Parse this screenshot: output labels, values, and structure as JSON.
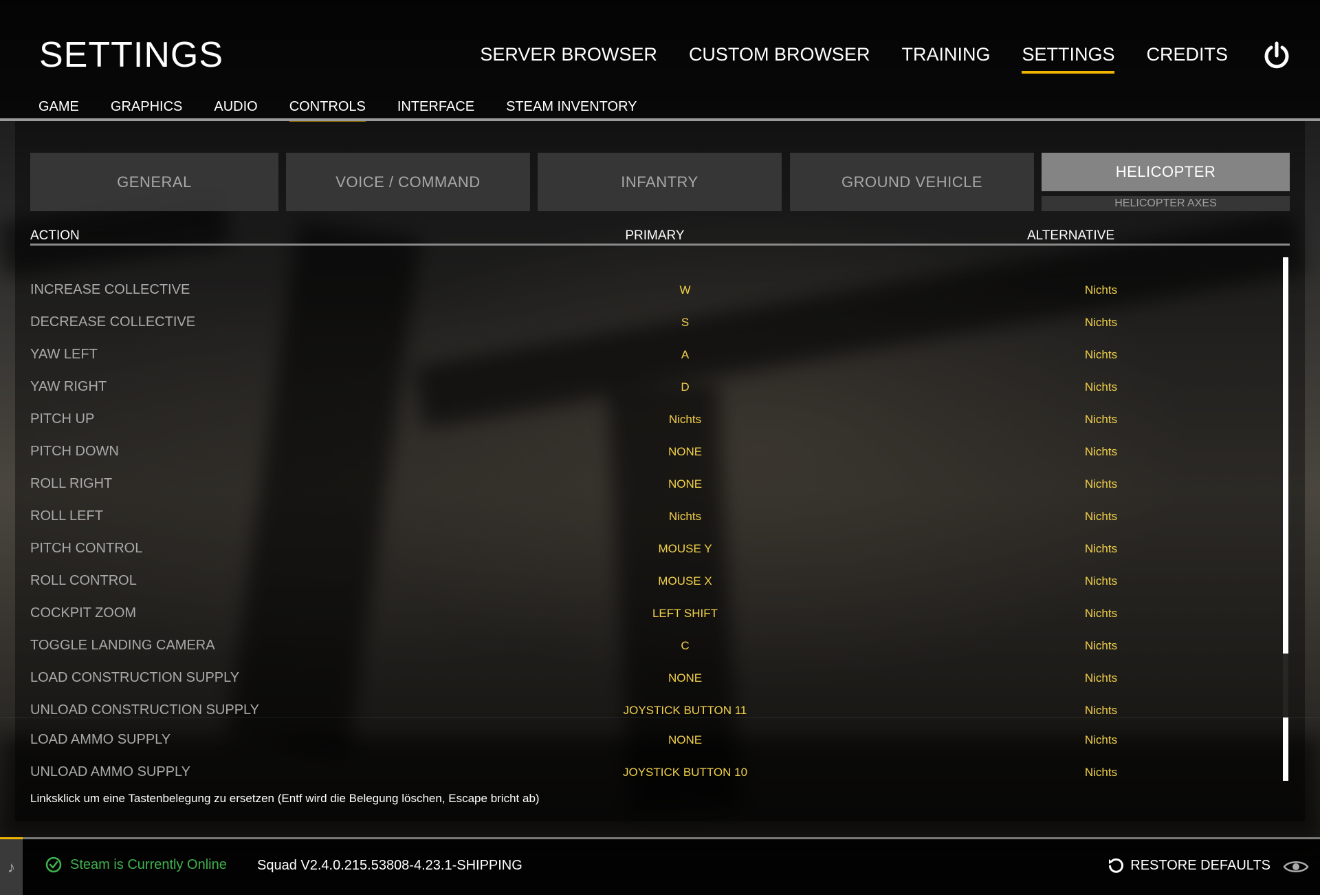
{
  "header": {
    "page_title": "SETTINGS",
    "main_nav": [
      "SERVER BROWSER",
      "CUSTOM BROWSER",
      "TRAINING",
      "SETTINGS",
      "CREDITS"
    ],
    "main_nav_active": "SETTINGS",
    "power_icon": "power-icon"
  },
  "sub_nav": {
    "items": [
      "GAME",
      "GRAPHICS",
      "AUDIO",
      "CONTROLS",
      "INTERFACE",
      "STEAM INVENTORY"
    ],
    "active": "CONTROLS"
  },
  "categories": {
    "tabs": [
      "GENERAL",
      "VOICE / COMMAND",
      "INFANTRY",
      "GROUND VEHICLE",
      "HELICOPTER"
    ],
    "active": "HELICOPTER",
    "active_sub": "HELICOPTER AXES"
  },
  "table": {
    "headers": {
      "action": "ACTION",
      "primary": "PRIMARY",
      "alternative": "ALTERNATIVE"
    },
    "rows": [
      {
        "action": "INCREASE COLLECTIVE",
        "primary": "W",
        "alternative": "Nichts"
      },
      {
        "action": "DECREASE COLLECTIVE",
        "primary": "S",
        "alternative": "Nichts"
      },
      {
        "action": "YAW LEFT",
        "primary": "A",
        "alternative": "Nichts"
      },
      {
        "action": "YAW RIGHT",
        "primary": "D",
        "alternative": "Nichts"
      },
      {
        "action": "PITCH UP",
        "primary": "Nichts",
        "alternative": "Nichts"
      },
      {
        "action": "PITCH DOWN",
        "primary": "NONE",
        "alternative": "Nichts"
      },
      {
        "action": "ROLL RIGHT",
        "primary": "NONE",
        "alternative": "Nichts"
      },
      {
        "action": "ROLL LEFT",
        "primary": "Nichts",
        "alternative": "Nichts"
      },
      {
        "action": "PITCH CONTROL",
        "primary": "MOUSE Y",
        "alternative": "Nichts"
      },
      {
        "action": "ROLL CONTROL",
        "primary": "MOUSE X",
        "alternative": "Nichts"
      },
      {
        "action": "COCKPIT ZOOM",
        "primary": "LEFT SHIFT",
        "alternative": "Nichts"
      },
      {
        "action": "TOGGLE LANDING CAMERA",
        "primary": "C",
        "alternative": "Nichts"
      },
      {
        "action": "LOAD CONSTRUCTION SUPPLY",
        "primary": "NONE",
        "alternative": "Nichts"
      },
      {
        "action": "UNLOAD CONSTRUCTION SUPPLY",
        "primary": "JOYSTICK BUTTON 11",
        "alternative": "Nichts"
      },
      {
        "action": "LOAD AMMO SUPPLY",
        "primary": "NONE",
        "alternative": "Nichts"
      },
      {
        "action": "UNLOAD AMMO SUPPLY",
        "primary": "JOYSTICK BUTTON 10",
        "alternative": "Nichts"
      }
    ]
  },
  "hint": "Linksklick um eine Tastenbelegung zu ersetzen (Entf wird die Belegung löschen, Escape bricht ab)",
  "footer": {
    "steam_status": "Steam is Currently Online",
    "version": "Squad V2.4.0.215.53808-4.23.1-SHIPPING",
    "restore_label": "RESTORE DEFAULTS"
  },
  "colors": {
    "accent": "#f0b400",
    "binding": "#f3d24a",
    "online": "#3fb24d"
  }
}
